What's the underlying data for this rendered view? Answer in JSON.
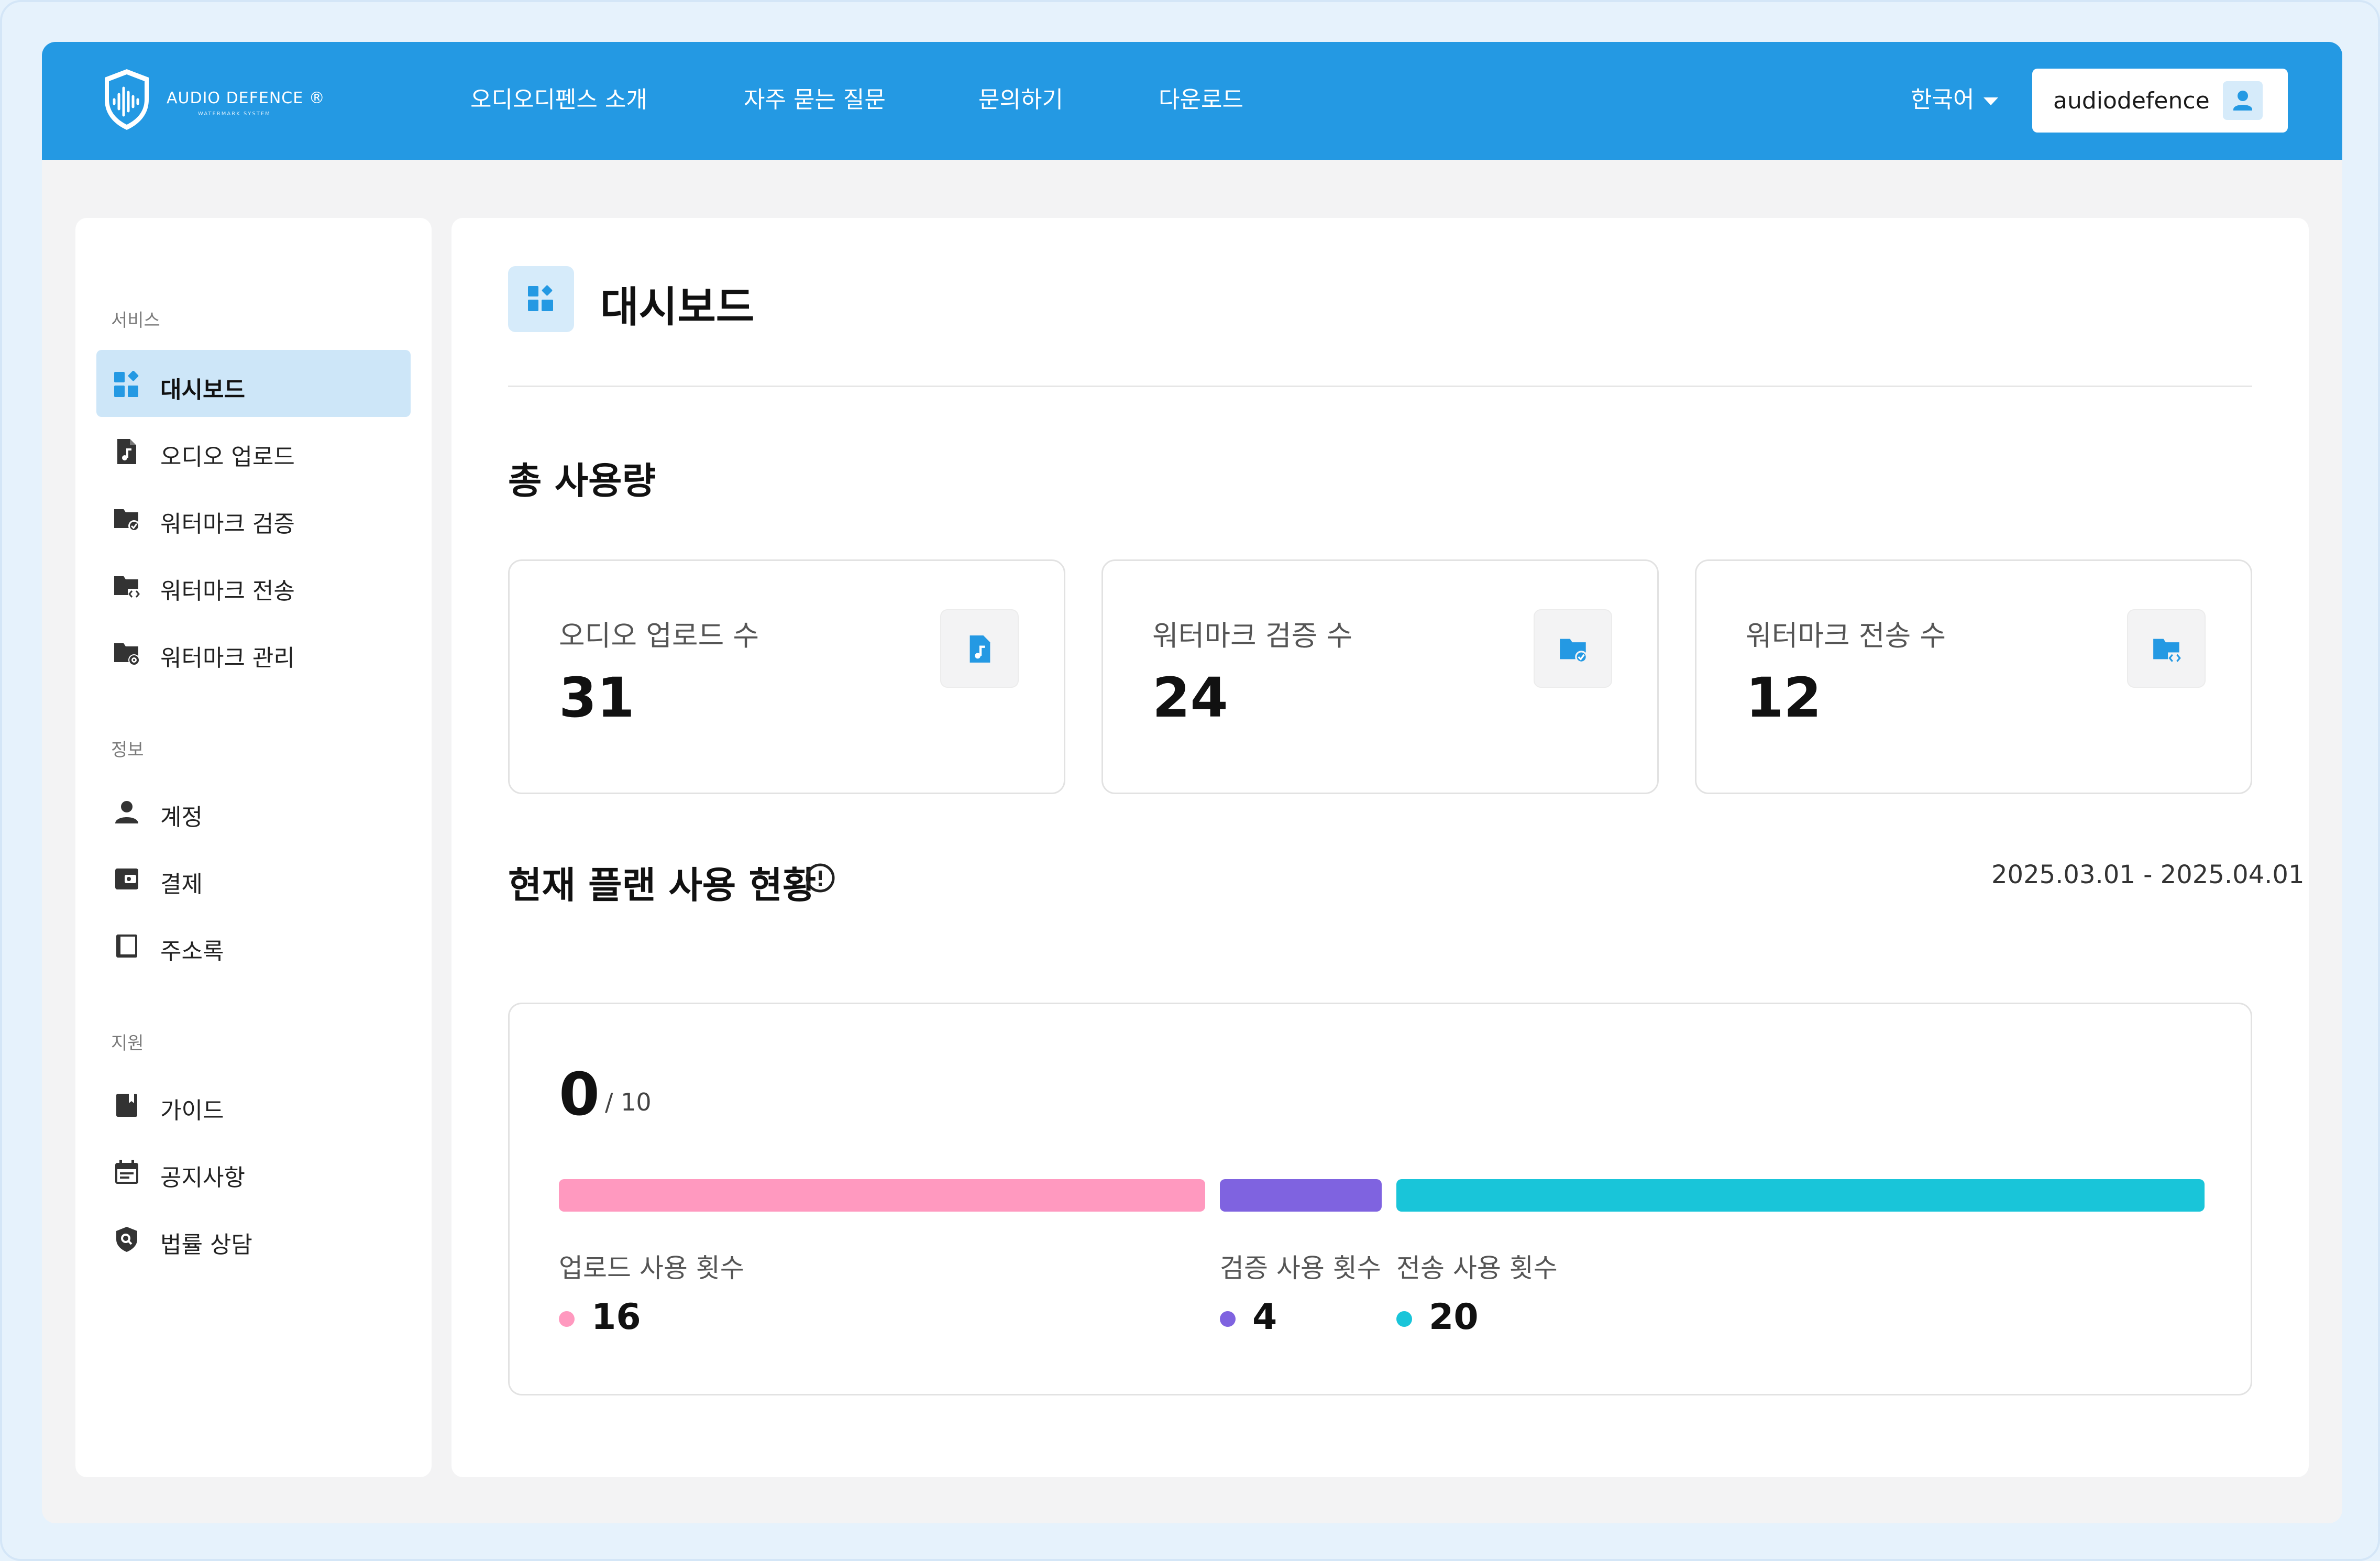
{
  "colors": {
    "header": "#2499e3",
    "accent": "#2499e3",
    "active_item_bg": "#cde6f8",
    "upload": "#ff99bf",
    "verify": "#7f63e0",
    "transfer": "#19c5d9"
  },
  "brand": {
    "title": "AUDIO DEFENCE ®",
    "subtitle": "WATERMARK SYSTEM"
  },
  "nav": [
    {
      "label": "오디오디펜스 소개"
    },
    {
      "label": "자주 묻는 질문"
    },
    {
      "label": "문의하기"
    },
    {
      "label": "다운로드"
    }
  ],
  "language": "한국어",
  "user": {
    "name": "audiodefence",
    "icon": "user-icon"
  },
  "sidebar": {
    "sections": [
      {
        "title": "서비스",
        "items": [
          {
            "label": "대시보드",
            "icon": "dashboard-icon",
            "active": true
          },
          {
            "label": "오디오 업로드",
            "icon": "audio-file-icon"
          },
          {
            "label": "워터마크 검증",
            "icon": "folder-check-icon"
          },
          {
            "label": "워터마크 전송",
            "icon": "folder-code-icon"
          },
          {
            "label": "워터마크 관리",
            "icon": "folder-gear-icon"
          }
        ]
      },
      {
        "title": "정보",
        "items": [
          {
            "label": "계정",
            "icon": "person-icon"
          },
          {
            "label": "결제",
            "icon": "wallet-icon"
          },
          {
            "label": "주소록",
            "icon": "address-book-icon"
          }
        ]
      },
      {
        "title": "지원",
        "items": [
          {
            "label": "가이드",
            "icon": "book-icon"
          },
          {
            "label": "공지사항",
            "icon": "calendar-icon"
          },
          {
            "label": "법률 상담",
            "icon": "shield-search-icon"
          }
        ]
      }
    ]
  },
  "page": {
    "title": "대시보드"
  },
  "total_usage": {
    "title": "총 사용량",
    "cards": [
      {
        "label": "오디오 업로드 수",
        "value": "31",
        "icon": "audio-file-icon"
      },
      {
        "label": "워터마크 검증 수",
        "value": "24",
        "icon": "folder-check-icon"
      },
      {
        "label": "워터마크 전송 수",
        "value": "12",
        "icon": "folder-code-icon"
      }
    ]
  },
  "plan_usage": {
    "title": "현재 플랜 사용 현황",
    "date_range": "2025.03.01 - 2025.04.01",
    "used": "0",
    "limit": "/ 10",
    "segments": [
      {
        "label": "업로드 사용 횟수",
        "value": 16
      },
      {
        "label": "검증 사용 횟수",
        "value": 4
      },
      {
        "label": "전송 사용 횟수",
        "value": 20
      }
    ]
  }
}
